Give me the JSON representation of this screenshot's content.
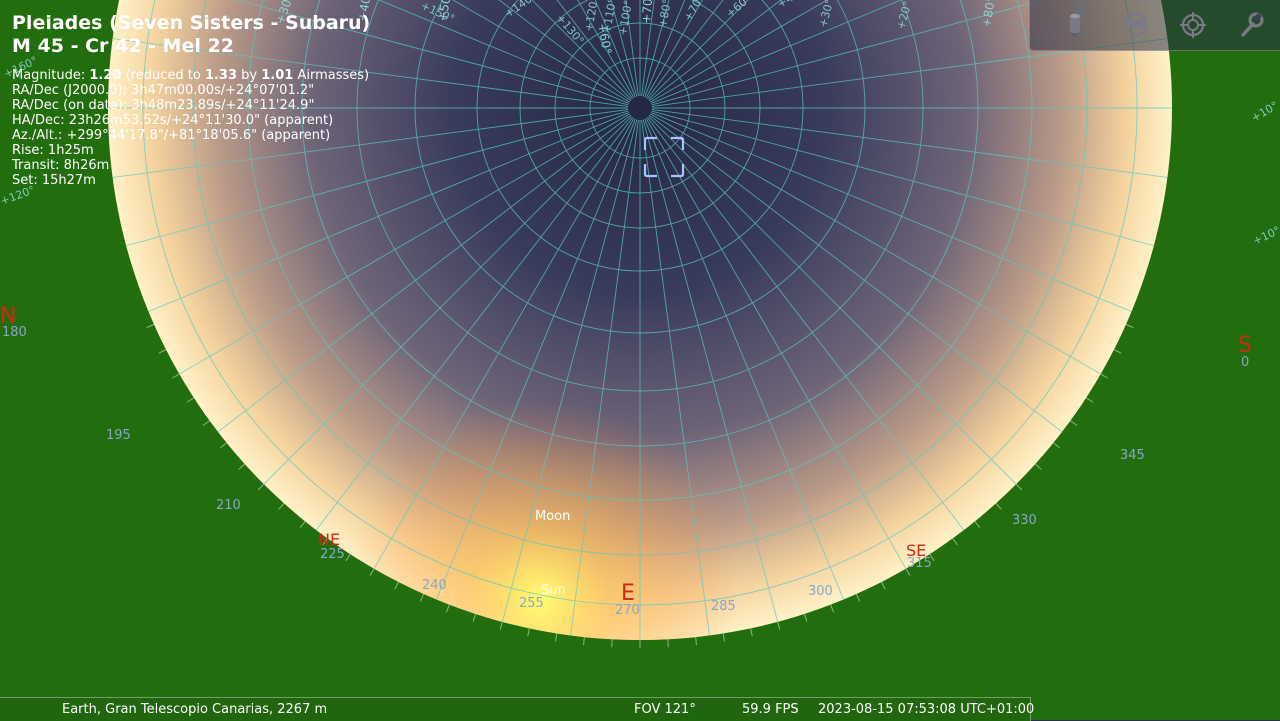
{
  "object": {
    "title_line1": "Pleiades (Seven Sisters - Subaru)",
    "title_line2": "M 45 - Cr 42 - Mel 22",
    "magnitude_label": "Magnitude: ",
    "magnitude": "1.20",
    "reduced_to_label": " (reduced to ",
    "reduced_magnitude": "1.33",
    "by_label": " by ",
    "airmass": "1.01",
    "airmass_suffix": " Airmasses)",
    "radec_j2000": "RA/Dec (J2000.0): 3h47m00.00s/+24°07'01.2\"",
    "radec_ondate": "RA/Dec (on date): 3h48m23.89s/+24°11'24.9\"",
    "hadec": "HA/Dec: 23h26m53.52s/+24°11'30.0\" (apparent)",
    "azalt": "Az./Alt.: +299°44'17.8\"/+81°18'05.6\" (apparent)",
    "rise": "Rise: 1h25m",
    "transit": "Transit: 8h26m",
    "set": "Set: 15h27m"
  },
  "sky": {
    "cardinals": [
      "N",
      "NE",
      "E",
      "SE",
      "S"
    ],
    "azimuth_labels": [
      "180",
      "195",
      "210",
      "225",
      "240",
      "255",
      "270",
      "285",
      "300",
      "315",
      "330",
      "345",
      "0"
    ],
    "objects": [
      "Moon",
      "Sun"
    ],
    "declination_labels": [
      "+30°",
      "+40°",
      "+50°",
      "+60°",
      "+70°",
      "+80°",
      "+90°"
    ],
    "hour_labels": [
      "+160°",
      "+150°",
      "+140°",
      "+130°",
      "+120°",
      "+110°",
      "+100°",
      "+80°",
      "+70°",
      "+60°",
      "+40°",
      "+30°",
      "+20°",
      "+10°",
      "+120°",
      "+10°"
    ],
    "ground_color": "#226e0e",
    "grid_color": "#5cc8c0",
    "label_color": "#8aa6c8",
    "cardinal_color": "#cc2a12"
  },
  "toolbar": {
    "icons": [
      "telescope-icon",
      "screen-icon",
      "target-icon",
      "wrench-icon"
    ]
  },
  "status": {
    "location": "Earth, Gran Telescopio Canarias, 2267 m",
    "fov": "FOV 121°",
    "fps": "59.9 FPS",
    "datetime": "2023-08-15 07:53:08 UTC+01:00"
  }
}
